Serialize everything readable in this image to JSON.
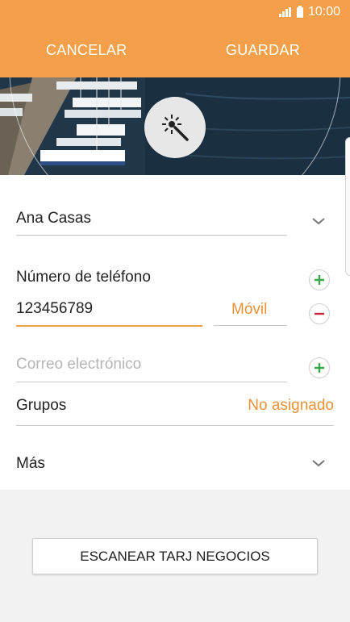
{
  "status_bar": {
    "time": "10:00"
  },
  "header": {
    "cancel_label": "CANCELAR",
    "save_label": "GUARDAR"
  },
  "form": {
    "name_value": "Ana Casas",
    "phone_section_label": "Número de teléfono",
    "phone_value": "123456789",
    "phone_type": "Móvil",
    "email_placeholder": "Correo electrónico",
    "groups_label": "Grupos",
    "groups_value": "No asignado",
    "more_label": "Más"
  },
  "scan_button_label": "ESCANEAR TARJ NEGOCIOS",
  "colors": {
    "accent": "#f4a04a",
    "accent_text": "#e8923a",
    "add": "#3aa84a",
    "remove": "#d0283c"
  },
  "icons": [
    "signal-icon",
    "battery-icon",
    "magic-wand-icon",
    "chevron-down-icon",
    "add-icon",
    "remove-icon"
  ]
}
